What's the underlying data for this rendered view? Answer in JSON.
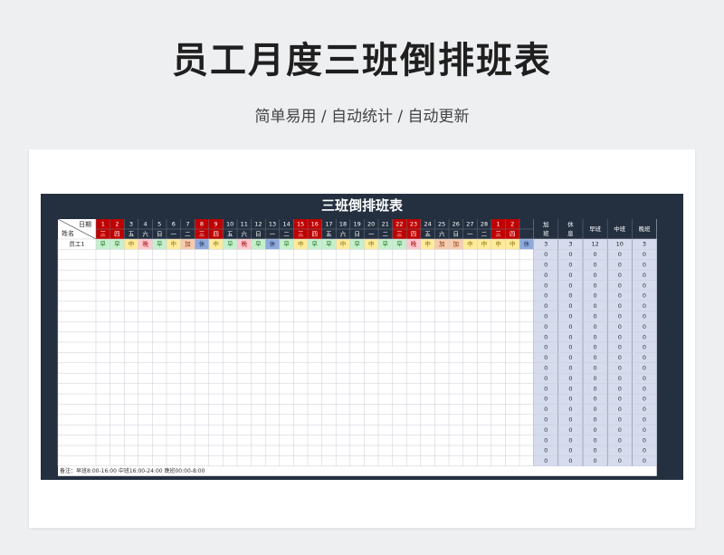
{
  "page": {
    "title": "员工月度三班倒排班表",
    "subtitle": "简单易用 / 自动统计 / 自动更新"
  },
  "sheet": {
    "title": "三班倒排班表",
    "header_date_label": "日期",
    "header_name_label": "姓名",
    "days": [
      "1",
      "2",
      "3",
      "4",
      "5",
      "6",
      "7",
      "8",
      "9",
      "10",
      "11",
      "12",
      "13",
      "14",
      "15",
      "16",
      "17",
      "18",
      "19",
      "20",
      "21",
      "22",
      "23",
      "24",
      "25",
      "26",
      "27",
      "28",
      "1",
      "2",
      ""
    ],
    "weekdays": [
      "三",
      "四",
      "五",
      "六",
      "日",
      "一",
      "二",
      "三",
      "四",
      "五",
      "六",
      "日",
      "一",
      "二",
      "三",
      "四",
      "五",
      "六",
      "日",
      "一",
      "二",
      "三",
      "四",
      "五",
      "六",
      "日",
      "一",
      "二",
      "三",
      "四",
      ""
    ],
    "highlight_columns": [
      0,
      1,
      7,
      8,
      14,
      15,
      21,
      22,
      28,
      29
    ],
    "summary_headers": [
      "加班",
      "休息",
      "早班",
      "中班",
      "晚班"
    ],
    "employee": {
      "name": "员工1",
      "shifts": [
        "早",
        "早",
        "中",
        "晚",
        "早",
        "中",
        "加",
        "休",
        "中",
        "早",
        "晚",
        "早",
        "休",
        "早",
        "中",
        "早",
        "早",
        "中",
        "早",
        "中",
        "早",
        "早",
        "晚",
        "中",
        "加",
        "加",
        "中",
        "中",
        "中",
        "中",
        "休"
      ],
      "summary": [
        "3",
        "3",
        "12",
        "10",
        "3"
      ]
    },
    "empty_row_count": 21,
    "empty_summary_value": "0",
    "footer_note": "备注：早班8:00-16:00    中班16:00-24:00          晚班00:00-8:00"
  },
  "colors": {
    "dark_bg": "#243040",
    "highlight_red": "#c00000",
    "summary_bg": "#d6dcee",
    "early": "#c6efce",
    "mid": "#ffeb9c",
    "late": "#ffc7ce",
    "overtime": "#f8cbad",
    "rest": "#8ea9db"
  },
  "shift_colors": {
    "早": {
      "bg": "#c6efce",
      "fg": "#2a7a2a"
    },
    "中": {
      "bg": "#ffeb9c",
      "fg": "#8a6a00"
    },
    "晚": {
      "bg": "#ffc7ce",
      "fg": "#9c0006"
    },
    "加": {
      "bg": "#f8cbad",
      "fg": "#7a3a10"
    },
    "休": {
      "bg": "#8ea9db",
      "fg": "#1f2f55"
    }
  }
}
